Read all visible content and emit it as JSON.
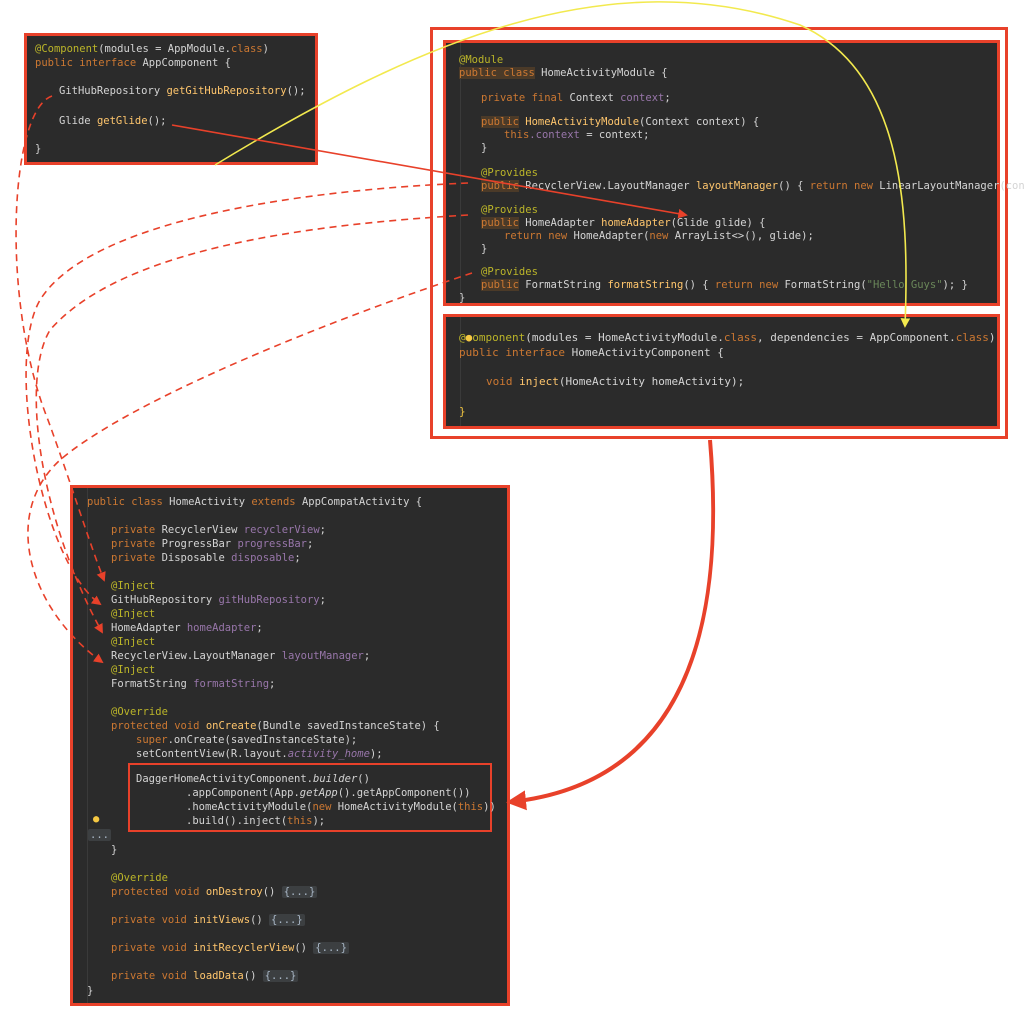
{
  "colors": {
    "panel_bg": "#2b2b2b",
    "frame_red": "#e8412a",
    "arrow_red": "#e8412a",
    "arrow_yellow": "#f2e94e",
    "keyword": "#cc7832",
    "annotation": "#bbb529",
    "method": "#ffc66d",
    "field": "#9876aa",
    "string": "#6a8759"
  },
  "app_component": {
    "annotation": "@Component",
    "line1_rest": "(modules = AppModule.",
    "class_kw": "class",
    "line1_end": ")",
    "decl_kw": "public interface",
    "name": " AppComponent {",
    "repo_type": "GitHubRepository ",
    "repo_method": "getGitHubRepository",
    "repo_end": "();",
    "glide_type": "Glide ",
    "glide_method": "getGlide",
    "glide_end": "();",
    "close": "}"
  },
  "home_module": {
    "annotation": "@Module",
    "decl_kw": "public class",
    "name": " HomeActivityModule {",
    "field_kw": "private final",
    "field_rest": " Context ",
    "field_name": "context",
    "field_end": ";",
    "ctor_kw": "public",
    "ctor_name": " HomeActivityModule",
    "ctor_rest": "(Context context) {",
    "this_kw": "this",
    "assign_field": ".context",
    "assign_rest": " = context;",
    "ctor_close": "}",
    "provides1": "@Provides",
    "p1_kw": "public",
    "p1_type": " RecyclerView.LayoutManager ",
    "p1_method": "layoutManager",
    "p1_body_kw": "return new",
    "p1_body_rest": " LinearLayoutManager(context); }",
    "p1_open": "() { ",
    "provides2": "@Provides",
    "p2_kw": "public",
    "p2_type": " HomeAdapter ",
    "p2_method": "homeAdapter",
    "p2_rest": "(Glide glide) {",
    "p2_ret_kw": "return new",
    "p2_ret_rest": " HomeAdapter(",
    "p2_new": "new",
    "p2_ret_end": " ArrayList<>(), glide);",
    "p2_close": "}",
    "provides3": "@Provides",
    "p3_kw": "public",
    "p3_type": " FormatString ",
    "p3_method": "formatString",
    "p3_open": "() { ",
    "p3_body_kw": "return new",
    "p3_body_rest": " FormatString(",
    "p3_string": "\"Hello Guys\"",
    "p3_end": "); }",
    "close": "}"
  },
  "home_component": {
    "annotation_a": "@",
    "annotation_b": "omponent",
    "rest1": "(modules = HomeActivityModule.",
    "class_kw1": "class",
    "rest2": ", dependencies = AppComponent.",
    "class_kw2": "class",
    "rest3": ")",
    "decl_kw": "public interface",
    "name": " HomeActivityComponent {",
    "void_kw": "void",
    "inject_method": " inject",
    "inject_rest": "(HomeActivity homeActivity);",
    "close": "}"
  },
  "home_activity": {
    "decl_kw": "public class",
    "name": " HomeActivity ",
    "extends_kw": "extends",
    "parent": " AppCompatActivity {",
    "f1_kw": "private",
    "f1_type": " RecyclerView ",
    "f1_name": "recyclerView",
    "f2_kw": "private",
    "f2_type": " ProgressBar ",
    "f2_name": "progressBar",
    "f3_kw": "private",
    "f3_type": " Disposable ",
    "f3_name": "disposable",
    "inject": "@Inject",
    "i1_type": "GitHubRepository ",
    "i1_name": "gitHubRepository",
    "i2_type": "HomeAdapter ",
    "i2_name": "homeAdapter",
    "i3_type": "RecyclerView.LayoutManager ",
    "i3_name": "layoutManager",
    "i4_type": "FormatString ",
    "i4_name": "formatString",
    "semi": ";",
    "override": "@Override",
    "oc_kw": "protected void",
    "oc_name": " onCreate",
    "oc_rest": "(Bundle savedInstanceState) {",
    "super_kw": "super",
    "super_rest": ".onCreate(savedInstanceState);",
    "scv": "setContentView(R.layout.",
    "scv_field": "activity_home",
    "scv_end": ");",
    "dagger1": "DaggerHomeActivityComponent.",
    "dagger1_b": "builder",
    "dagger1_c": "()",
    "dagger2_a": ".appComponent(App.",
    "dagger2_b": "getApp",
    "dagger2_c": "().getAppComponent())",
    "dagger3_a": ".homeActivityModule(",
    "dagger3_new": "new",
    "dagger3_b": " HomeActivityModule(",
    "dagger3_this": "this",
    "dagger3_c": "))",
    "dagger4_a": ".build().inject(",
    "dagger4_this": "this",
    "dagger4_b": ");",
    "ellipsis": "...",
    "oc_close": "}",
    "od_kw": "protected void",
    "od_name": " onDestroy",
    "od_rest": "() ",
    "fold": "{...}",
    "iv_kw": "private void",
    "iv_name": " initViews",
    "irv_kw": "private void",
    "irv_name": " initRecyclerView",
    "ld_kw": "private void",
    "ld_name": " loadData",
    "close": "}"
  }
}
